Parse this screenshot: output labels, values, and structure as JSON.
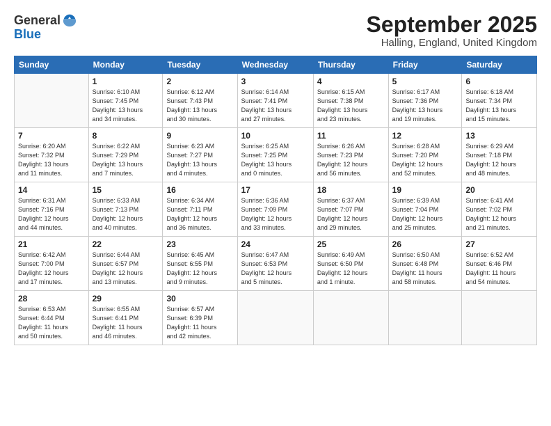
{
  "header": {
    "logo_line1": "General",
    "logo_line2": "Blue",
    "month_title": "September 2025",
    "location": "Halling, England, United Kingdom"
  },
  "weekdays": [
    "Sunday",
    "Monday",
    "Tuesday",
    "Wednesday",
    "Thursday",
    "Friday",
    "Saturday"
  ],
  "weeks": [
    [
      {
        "day": "",
        "info": ""
      },
      {
        "day": "1",
        "info": "Sunrise: 6:10 AM\nSunset: 7:45 PM\nDaylight: 13 hours\nand 34 minutes."
      },
      {
        "day": "2",
        "info": "Sunrise: 6:12 AM\nSunset: 7:43 PM\nDaylight: 13 hours\nand 30 minutes."
      },
      {
        "day": "3",
        "info": "Sunrise: 6:14 AM\nSunset: 7:41 PM\nDaylight: 13 hours\nand 27 minutes."
      },
      {
        "day": "4",
        "info": "Sunrise: 6:15 AM\nSunset: 7:38 PM\nDaylight: 13 hours\nand 23 minutes."
      },
      {
        "day": "5",
        "info": "Sunrise: 6:17 AM\nSunset: 7:36 PM\nDaylight: 13 hours\nand 19 minutes."
      },
      {
        "day": "6",
        "info": "Sunrise: 6:18 AM\nSunset: 7:34 PM\nDaylight: 13 hours\nand 15 minutes."
      }
    ],
    [
      {
        "day": "7",
        "info": "Sunrise: 6:20 AM\nSunset: 7:32 PM\nDaylight: 13 hours\nand 11 minutes."
      },
      {
        "day": "8",
        "info": "Sunrise: 6:22 AM\nSunset: 7:29 PM\nDaylight: 13 hours\nand 7 minutes."
      },
      {
        "day": "9",
        "info": "Sunrise: 6:23 AM\nSunset: 7:27 PM\nDaylight: 13 hours\nand 4 minutes."
      },
      {
        "day": "10",
        "info": "Sunrise: 6:25 AM\nSunset: 7:25 PM\nDaylight: 13 hours\nand 0 minutes."
      },
      {
        "day": "11",
        "info": "Sunrise: 6:26 AM\nSunset: 7:23 PM\nDaylight: 12 hours\nand 56 minutes."
      },
      {
        "day": "12",
        "info": "Sunrise: 6:28 AM\nSunset: 7:20 PM\nDaylight: 12 hours\nand 52 minutes."
      },
      {
        "day": "13",
        "info": "Sunrise: 6:29 AM\nSunset: 7:18 PM\nDaylight: 12 hours\nand 48 minutes."
      }
    ],
    [
      {
        "day": "14",
        "info": "Sunrise: 6:31 AM\nSunset: 7:16 PM\nDaylight: 12 hours\nand 44 minutes."
      },
      {
        "day": "15",
        "info": "Sunrise: 6:33 AM\nSunset: 7:13 PM\nDaylight: 12 hours\nand 40 minutes."
      },
      {
        "day": "16",
        "info": "Sunrise: 6:34 AM\nSunset: 7:11 PM\nDaylight: 12 hours\nand 36 minutes."
      },
      {
        "day": "17",
        "info": "Sunrise: 6:36 AM\nSunset: 7:09 PM\nDaylight: 12 hours\nand 33 minutes."
      },
      {
        "day": "18",
        "info": "Sunrise: 6:37 AM\nSunset: 7:07 PM\nDaylight: 12 hours\nand 29 minutes."
      },
      {
        "day": "19",
        "info": "Sunrise: 6:39 AM\nSunset: 7:04 PM\nDaylight: 12 hours\nand 25 minutes."
      },
      {
        "day": "20",
        "info": "Sunrise: 6:41 AM\nSunset: 7:02 PM\nDaylight: 12 hours\nand 21 minutes."
      }
    ],
    [
      {
        "day": "21",
        "info": "Sunrise: 6:42 AM\nSunset: 7:00 PM\nDaylight: 12 hours\nand 17 minutes."
      },
      {
        "day": "22",
        "info": "Sunrise: 6:44 AM\nSunset: 6:57 PM\nDaylight: 12 hours\nand 13 minutes."
      },
      {
        "day": "23",
        "info": "Sunrise: 6:45 AM\nSunset: 6:55 PM\nDaylight: 12 hours\nand 9 minutes."
      },
      {
        "day": "24",
        "info": "Sunrise: 6:47 AM\nSunset: 6:53 PM\nDaylight: 12 hours\nand 5 minutes."
      },
      {
        "day": "25",
        "info": "Sunrise: 6:49 AM\nSunset: 6:50 PM\nDaylight: 12 hours\nand 1 minute."
      },
      {
        "day": "26",
        "info": "Sunrise: 6:50 AM\nSunset: 6:48 PM\nDaylight: 11 hours\nand 58 minutes."
      },
      {
        "day": "27",
        "info": "Sunrise: 6:52 AM\nSunset: 6:46 PM\nDaylight: 11 hours\nand 54 minutes."
      }
    ],
    [
      {
        "day": "28",
        "info": "Sunrise: 6:53 AM\nSunset: 6:44 PM\nDaylight: 11 hours\nand 50 minutes."
      },
      {
        "day": "29",
        "info": "Sunrise: 6:55 AM\nSunset: 6:41 PM\nDaylight: 11 hours\nand 46 minutes."
      },
      {
        "day": "30",
        "info": "Sunrise: 6:57 AM\nSunset: 6:39 PM\nDaylight: 11 hours\nand 42 minutes."
      },
      {
        "day": "",
        "info": ""
      },
      {
        "day": "",
        "info": ""
      },
      {
        "day": "",
        "info": ""
      },
      {
        "day": "",
        "info": ""
      }
    ]
  ]
}
